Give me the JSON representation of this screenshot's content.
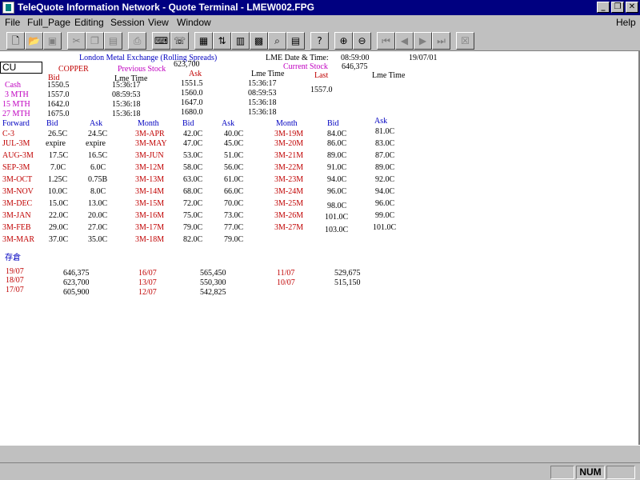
{
  "window": {
    "title": "TeleQuote Information Network - Quote Terminal - LMEW002.FPG"
  },
  "menu": {
    "file": "File",
    "full_page": "Full_Page",
    "editing": "Editing",
    "session": "Session",
    "view": "View",
    "window": "Window",
    "help": "Help"
  },
  "status": {
    "num": "NUM"
  },
  "header": {
    "symbol": "CU",
    "exchange": "London Metal Exchange (Rolling Spreads)",
    "commodity": "COPPER",
    "date_time_label": "LME Date & Time:",
    "time": "08:59:00",
    "date": "19/07/01",
    "prev_stock_value": "623,700",
    "current_stock_value": "646,375",
    "previous_stock_label": "Previous Stock",
    "current_stock_label": "Current Stock"
  },
  "quote_headers": {
    "bid": "Bid",
    "lme_time": "Lme Time",
    "ask": "Ask",
    "last": "Last"
  },
  "quotes": [
    {
      "label": "Cash",
      "bid": "1550.5",
      "bid_time": "15:36:17",
      "ask": "1551.5",
      "ask_time": "15:36:17"
    },
    {
      "label": "3 MTH",
      "bid": "1557.0",
      "bid_time": "08:59:53",
      "ask": "1560.0",
      "ask_time": "08:59:53"
    },
    {
      "label": "15 MTH",
      "bid": "1642.0",
      "bid_time": "15:36:18",
      "ask": "1647.0",
      "ask_time": "15:36:18"
    },
    {
      "label": "27 MTH",
      "bid": "1675.0",
      "bid_time": "15:36:18",
      "ask": "1680.0",
      "ask_time": "15:36:18"
    }
  ],
  "last_value": "1557.0",
  "spread_headers": {
    "forward": "Forward",
    "bid": "Bid",
    "ask": "Ask",
    "month": "Month"
  },
  "spreads_col1": [
    {
      "label": "C-3",
      "bid": "26.5C",
      "ask": "24.5C"
    },
    {
      "label": "JUL-3M",
      "bid": "expire",
      "ask": "expire"
    },
    {
      "label": "AUG-3M",
      "bid": "17.5C",
      "ask": "16.5C"
    },
    {
      "label": "SEP-3M",
      "bid": "7.0C",
      "ask": "6.0C"
    },
    {
      "label": "3M-OCT",
      "bid": "1.25C",
      "ask": "0.75B"
    },
    {
      "label": "3M-NOV",
      "bid": "10.0C",
      "ask": "8.0C"
    },
    {
      "label": "3M-DEC",
      "bid": "15.0C",
      "ask": "13.0C"
    },
    {
      "label": "3M-JAN",
      "bid": "22.0C",
      "ask": "20.0C"
    },
    {
      "label": "3M-FEB",
      "bid": "29.0C",
      "ask": "27.0C"
    },
    {
      "label": "3M-MAR",
      "bid": "37.0C",
      "ask": "35.0C"
    }
  ],
  "spreads_col2": [
    {
      "label": "3M-APR",
      "bid": "42.0C",
      "ask": "40.0C"
    },
    {
      "label": "3M-MAY",
      "bid": "47.0C",
      "ask": "45.0C"
    },
    {
      "label": "3M-JUN",
      "bid": "53.0C",
      "ask": "51.0C"
    },
    {
      "label": "3M-12M",
      "bid": "58.0C",
      "ask": "56.0C"
    },
    {
      "label": "3M-13M",
      "bid": "63.0C",
      "ask": "61.0C"
    },
    {
      "label": "3M-14M",
      "bid": "68.0C",
      "ask": "66.0C"
    },
    {
      "label": "3M-15M",
      "bid": "72.0C",
      "ask": "70.0C"
    },
    {
      "label": "3M-16M",
      "bid": "75.0C",
      "ask": "73.0C"
    },
    {
      "label": "3M-17M",
      "bid": "79.0C",
      "ask": "77.0C"
    },
    {
      "label": "3M-18M",
      "bid": "82.0C",
      "ask": "79.0C"
    }
  ],
  "spreads_col3": [
    {
      "label": "3M-19M",
      "bid": "84.0C",
      "ask": "81.0C"
    },
    {
      "label": "3M-20M",
      "bid": "86.0C",
      "ask": "83.0C"
    },
    {
      "label": "3M-21M",
      "bid": "89.0C",
      "ask": "87.0C"
    },
    {
      "label": "3M-22M",
      "bid": "91.0C",
      "ask": "89.0C"
    },
    {
      "label": "3M-23M",
      "bid": "94.0C",
      "ask": "92.0C"
    },
    {
      "label": "3M-24M",
      "bid": "96.0C",
      "ask": "94.0C"
    },
    {
      "label": "3M-25M",
      "bid": "98.0C",
      "ask": "96.0C"
    },
    {
      "label": "3M-26M",
      "bid": "101.0C",
      "ask": "99.0C"
    },
    {
      "label": "3M-27M",
      "bid": "103.0C",
      "ask": "101.0C"
    }
  ],
  "stock_section": {
    "title": "存倉"
  },
  "stock_history": [
    {
      "date": "19/07",
      "value": "646,375"
    },
    {
      "date": "18/07",
      "value": "623,700"
    },
    {
      "date": "17/07",
      "value": "605,900"
    },
    {
      "date": "16/07",
      "value": "565,450"
    },
    {
      "date": "13/07",
      "value": "550,300"
    },
    {
      "date": "12/07",
      "value": "542,825"
    },
    {
      "date": "11/07",
      "value": "529,675"
    },
    {
      "date": "10/07",
      "value": "515,150"
    }
  ],
  "colors": {
    "title_bar": "#000080",
    "label_blue": "#0000c0",
    "label_red": "#c00000",
    "label_magenta": "#c000c0"
  },
  "toolbar_icons": [
    "new-file-icon",
    "open-folder-icon",
    "save-icon",
    "cut-icon",
    "copy-icon",
    "paste-icon",
    "print-icon",
    "keyboard-icon",
    "phone-icon",
    "grid-icon",
    "sort-icon",
    "chart-icon",
    "live-icon",
    "zoom-page-icon",
    "page-list-icon",
    "help-icon",
    "zoom-in-icon",
    "zoom-out-icon",
    "first-page-icon",
    "prev-page-icon",
    "next-page-icon",
    "last-page-icon",
    "close-page-icon"
  ]
}
